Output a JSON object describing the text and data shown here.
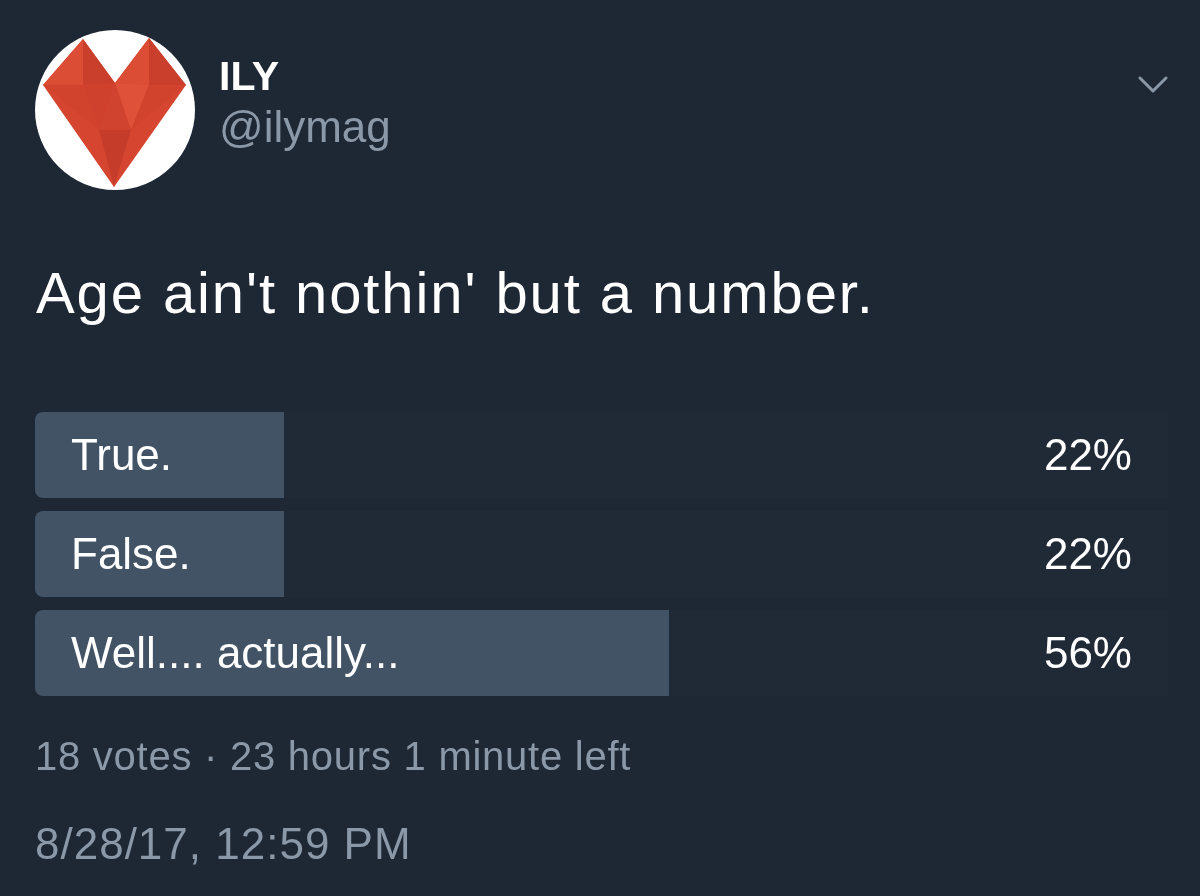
{
  "tweet": {
    "author": {
      "name": "ILY",
      "handle": "@ilymag"
    },
    "text": "Age ain't nothin' but a number.",
    "poll": {
      "options": [
        {
          "label": "True.",
          "percent": "22%",
          "level": 0.22
        },
        {
          "label": "False.",
          "percent": "22%",
          "level": 0.22
        },
        {
          "label": "Well.... actually...",
          "percent": "56%",
          "level": 0.56
        }
      ],
      "summary": "18 votes · 23 hours 1 minute left"
    },
    "timestamp": "8/28/17, 12:59 PM"
  }
}
